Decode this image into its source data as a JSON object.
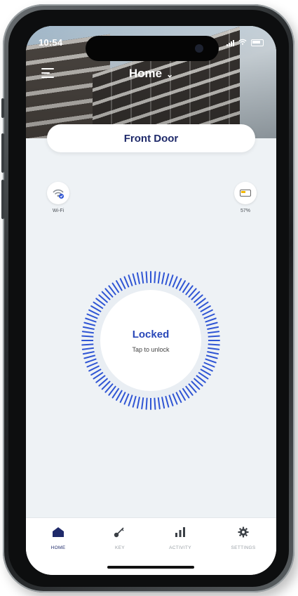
{
  "status_bar": {
    "time": "10:54"
  },
  "header": {
    "title": "Home",
    "chevron": "⌄"
  },
  "lock_card": {
    "name": "Front Door"
  },
  "indicators": {
    "wifi": {
      "label": "Wi-Fi",
      "icon": "wifi-icon"
    },
    "battery": {
      "label": "57%",
      "icon": "battery-icon",
      "level": 0.57
    }
  },
  "lock": {
    "state": "Locked",
    "hint": "Tap to unlock",
    "accent": "#2f55d4"
  },
  "tabs": [
    {
      "label": "HOME",
      "icon": "home-icon",
      "active": true
    },
    {
      "label": "KEY",
      "icon": "key-icon",
      "active": false
    },
    {
      "label": "ACTIVITY",
      "icon": "activity-icon",
      "active": false
    },
    {
      "label": "SETTINGS",
      "icon": "gear-icon",
      "active": false
    }
  ]
}
